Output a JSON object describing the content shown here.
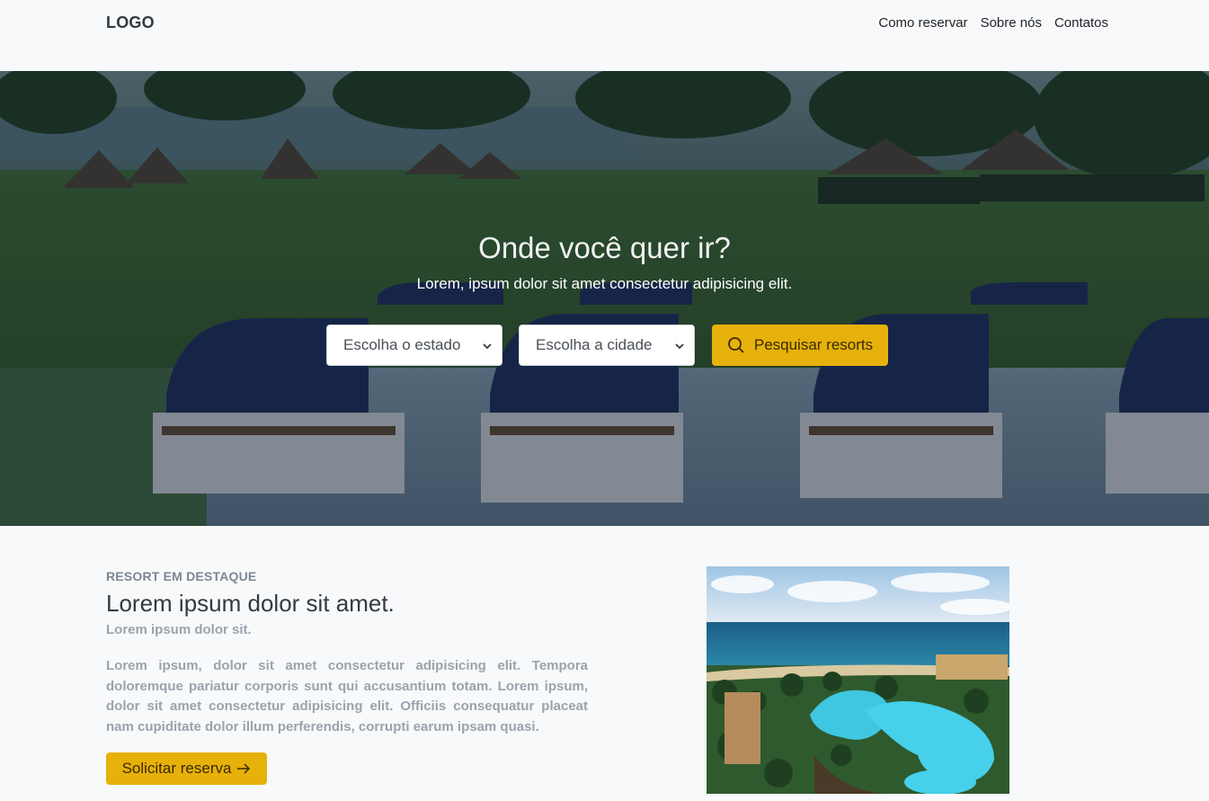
{
  "nav": {
    "logo": "LOGO",
    "links": [
      "Como reservar",
      "Sobre nós",
      "Contatos"
    ]
  },
  "hero": {
    "title": "Onde você quer ir?",
    "subtitle": "Lorem, ipsum dolor sit amet consectetur adipisicing elit.",
    "state_select": "Escolha o estado",
    "city_select": "Escolha a cidade",
    "search_button": "Pesquisar resorts"
  },
  "featured": {
    "eyebrow": "RESORT EM DESTAQUE",
    "title": "Lorem ipsum dolor sit amet.",
    "subtitle": "Lorem ipsum dolor sit.",
    "body": "Lorem ipsum, dolor sit amet consectetur adipisicing elit. Tempora doloremque pariatur corporis sunt qui accusantium totam. Lorem ipsum, dolor sit amet consectetur adipisicing elit. Officiis consequatur placeat nam cupiditate dolor illum perferendis, corrupti earum ipsam quasi.",
    "button": "Solicitar reserva"
  },
  "colors": {
    "accent": "#e6b10a",
    "background": "#f8f9fa"
  },
  "icons": {
    "search": "search-icon",
    "arrow": "arrow-right-icon",
    "chevron": "chevron-down-icon"
  }
}
